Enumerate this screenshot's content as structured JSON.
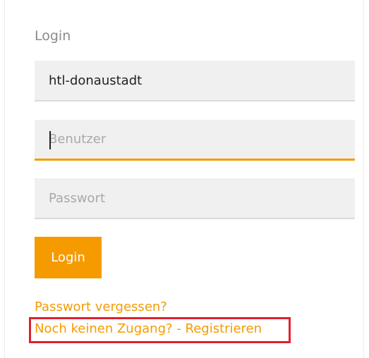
{
  "login": {
    "title": "Login",
    "school_value": "htl-donaustadt",
    "user_placeholder": "Benutzer",
    "password_placeholder": "Passwort",
    "submit_label": "Login",
    "forgot_password_link": "Passwort vergessen?",
    "register_link": "Noch keinen Zugang? - Registrieren"
  },
  "colors": {
    "accent": "#f59b00",
    "field_background": "#f0f0f0",
    "highlight": "#e0202e"
  }
}
